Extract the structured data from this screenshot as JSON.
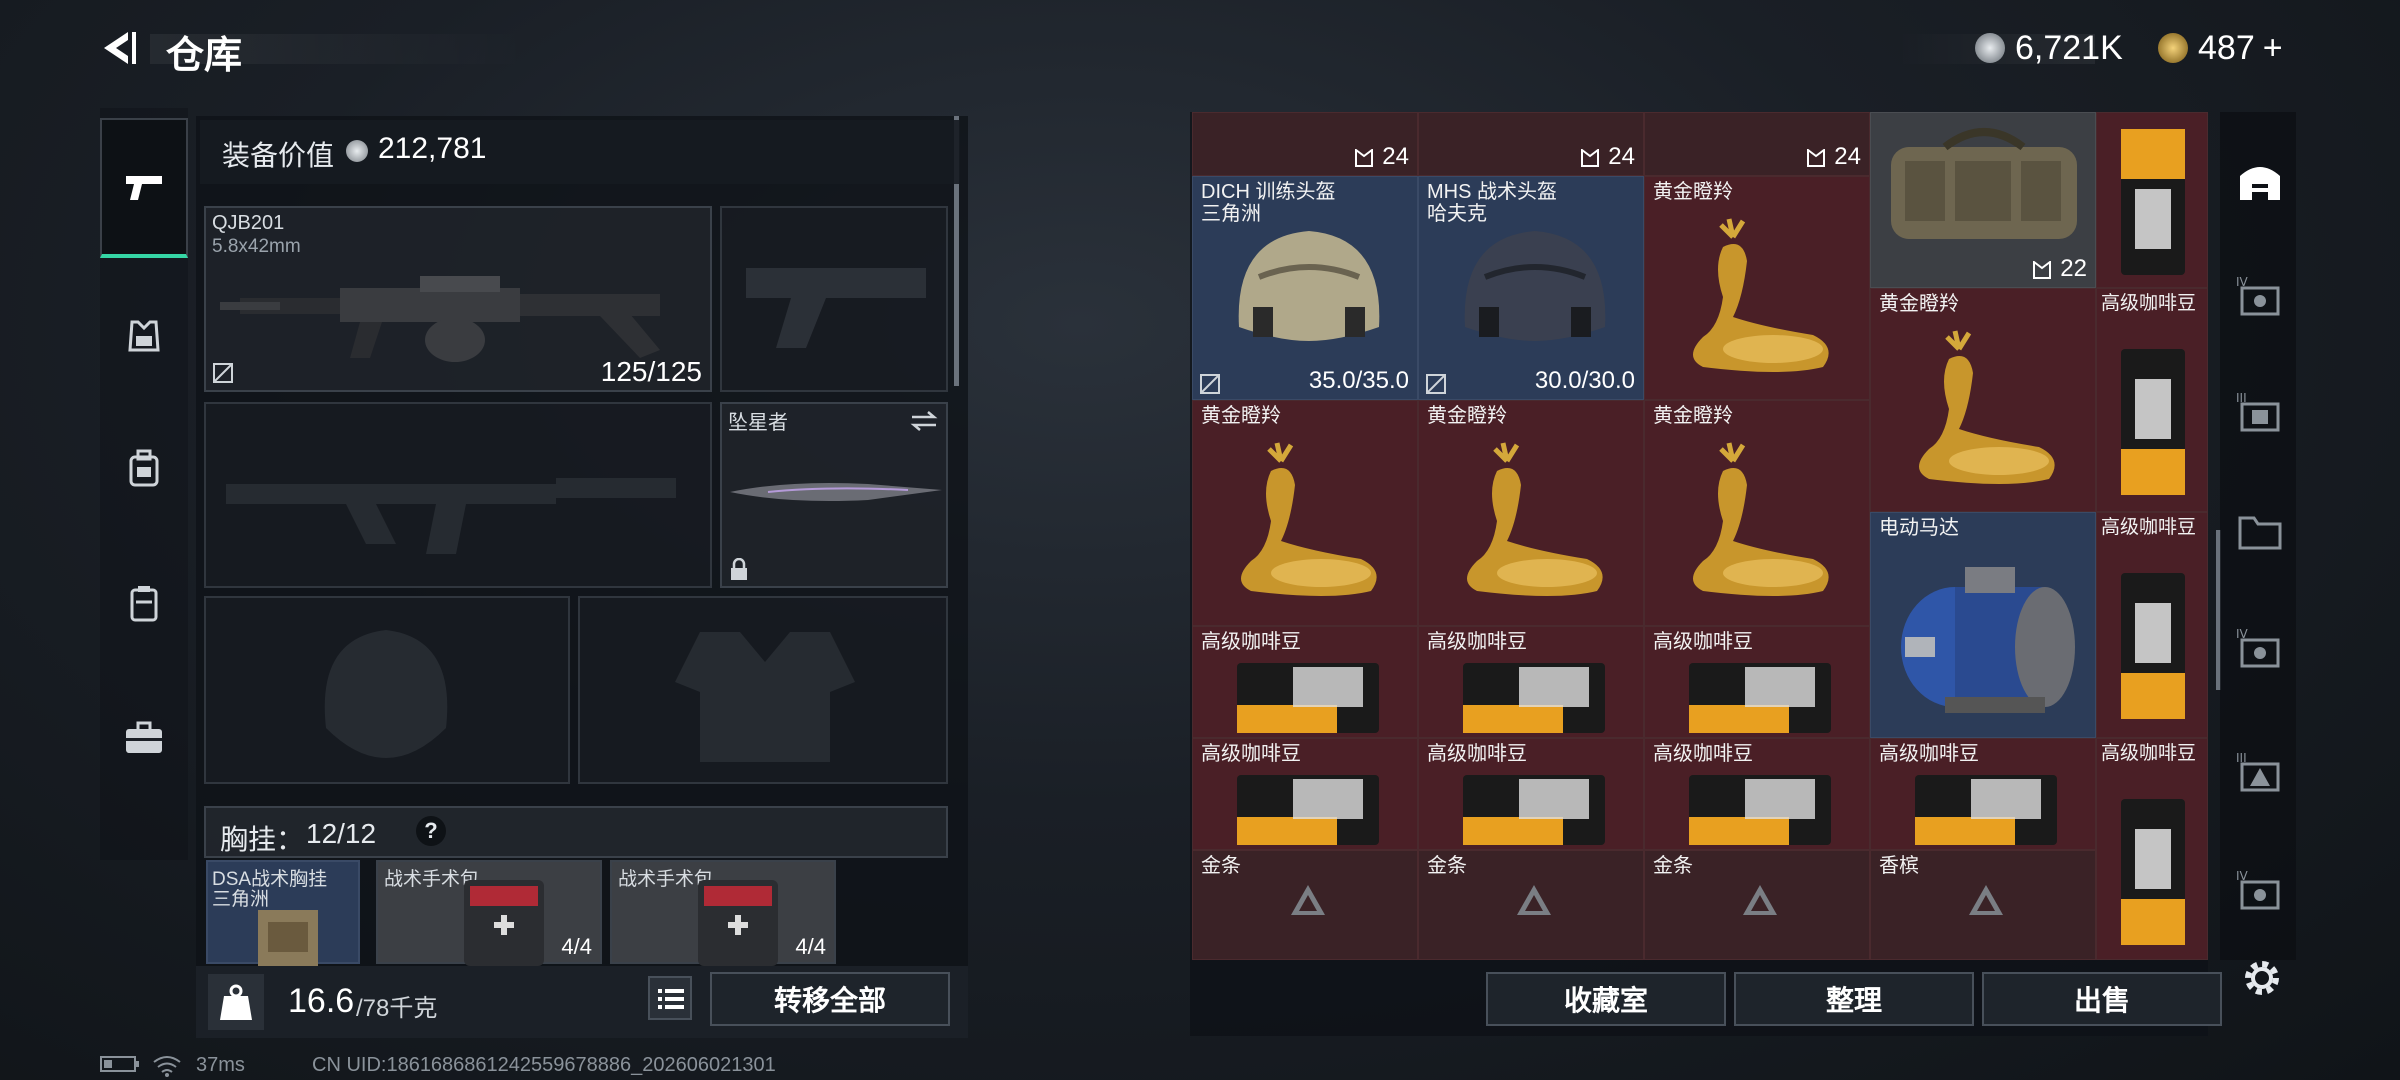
{
  "header": {
    "title": "仓库",
    "currency_a": "6,721K",
    "currency_b": "487",
    "currency_b_add": "+"
  },
  "colors": {
    "accent": "#35d6a5",
    "item_bg": "#4a1f26",
    "helmet_bg": "#2c3c58"
  },
  "left_nav": {
    "items": [
      "gun-icon",
      "vest-icon",
      "backpack-icon",
      "chest-rig-icon",
      "toolbox-icon"
    ],
    "active": 0
  },
  "equipment": {
    "value_label": "装备价值",
    "value": "212,781",
    "primary": {
      "name": "QJB201",
      "caliber": "5.8x42mm",
      "durability": "125/125"
    },
    "melee": {
      "name": "坠星者"
    },
    "chest_label": "胸挂：",
    "chest_count": "12/12",
    "chest_help": "?",
    "chest_items": [
      {
        "name": "DSA战术胸挂",
        "sub": "三角洲"
      },
      {
        "name": "战术手术包",
        "count": "4/4"
      },
      {
        "name": "战术手术包",
        "count": "4/4"
      }
    ]
  },
  "weight": {
    "current": "16.6",
    "max": "/78千克"
  },
  "buttons": {
    "transfer_all": "转移全部",
    "collection": "收藏室",
    "sort": "整理",
    "sell": "出售"
  },
  "stash": {
    "top_counts": [
      "24",
      "24",
      "24"
    ],
    "bag_count": "22",
    "items": {
      "helmet1": {
        "name": "DICH 训练头盔",
        "sub": "三角洲",
        "durability": "35.0/35.0"
      },
      "helmet2": {
        "name": "MHS 战术头盔",
        "sub": "哈夫克",
        "durability": "30.0/30.0"
      },
      "deer": "黄金瞪羚",
      "coffee": "高级咖啡豆",
      "motor": "电动马达",
      "gold": "金条",
      "champagne": "香槟"
    }
  },
  "status": {
    "ping": "37ms",
    "uid": "CN UID:1861686861242559678886_202606021301"
  }
}
